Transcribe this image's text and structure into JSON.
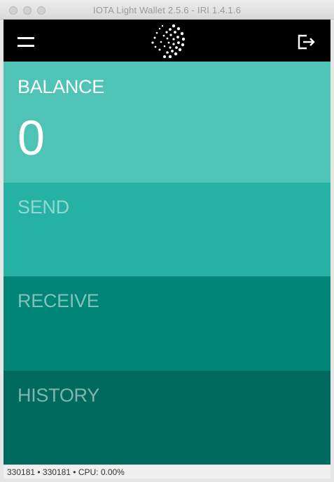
{
  "window": {
    "title": "IOTA Light Wallet 2.5.6 - IRI 1.4.1.6"
  },
  "header": {
    "menu_icon": "hamburger-menu-icon",
    "logo_icon": "iota-logo-icon",
    "logout_icon": "logout-icon"
  },
  "panels": {
    "balance": {
      "label": "BALANCE",
      "amount": "0"
    },
    "send": {
      "label": "SEND"
    },
    "receive": {
      "label": "RECEIVE"
    },
    "history": {
      "label": "HISTORY"
    }
  },
  "status": {
    "text": "330181 • 330181 • CPU: 0.00%"
  },
  "colors": {
    "header": "#000000",
    "balance": "#50c3b7",
    "send": "#26b1a5",
    "receive": "#018576",
    "history": "#016a5e"
  }
}
